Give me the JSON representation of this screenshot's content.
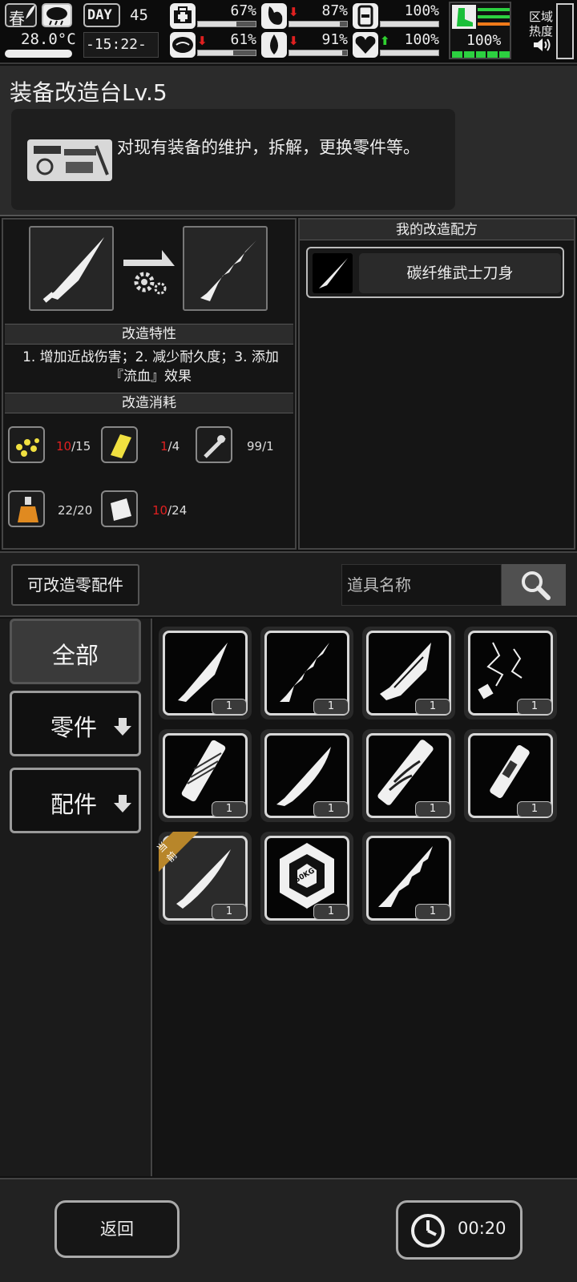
{
  "status": {
    "season": "春",
    "temperature": "28.0°C",
    "day_label": "DAY",
    "day_number": "45",
    "time": "-15:22-",
    "stats": [
      {
        "icon": "medkit-icon",
        "value": "67%",
        "trend": "none",
        "level": 0.67
      },
      {
        "icon": "stomach-icon",
        "value": "87%",
        "trend": "down",
        "level": 0.87
      },
      {
        "icon": "battery-icon",
        "value": "100%",
        "trend": "none",
        "level": 1.0
      },
      {
        "icon": "brain-icon",
        "value": "61%",
        "trend": "down",
        "level": 0.61
      },
      {
        "icon": "water-drop-icon",
        "value": "91%",
        "trend": "down",
        "level": 0.91
      },
      {
        "icon": "heart-icon",
        "value": "100%",
        "trend": "up",
        "level": 1.0
      }
    ],
    "stamina_value": "100%",
    "zone_heat_label_line1": "区域",
    "zone_heat_label_line2": "热度"
  },
  "header": {
    "title": "装备改造台Lv.5",
    "description": "对现有装备的维护，拆解，更换零件等。"
  },
  "recipe": {
    "traits_title": "改造特性",
    "traits_line1": "1. 增加近战伤害；2. 减少耐久度；3. 添加",
    "traits_line2": "『流血』效果",
    "cost_title": "改造消耗",
    "costs": [
      {
        "icon": "scrap-pile-icon",
        "have": "10",
        "need": "15",
        "insufficient": true
      },
      {
        "icon": "gold-bar-icon",
        "have": "1",
        "need": "4",
        "insufficient": true
      },
      {
        "icon": "grinder-tool-icon",
        "have": "99",
        "need": "1",
        "insufficient": false
      },
      {
        "icon": "chemical-flask-icon",
        "have": "22",
        "need": "20",
        "insufficient": false
      },
      {
        "icon": "cloth-sheet-icon",
        "have": "10",
        "need": "24",
        "insufficient": true
      }
    ],
    "my_recipes_title": "我的改造配方",
    "recipe_item_name": "碳纤维武士刀身"
  },
  "search": {
    "parts_label": "可改造零配件",
    "placeholder": "道具名称"
  },
  "sidebar": {
    "items": [
      {
        "label": "全部",
        "active": true
      },
      {
        "label": "零件",
        "active": false
      },
      {
        "label": "配件",
        "active": false
      }
    ]
  },
  "grid": {
    "current_tag": "当前",
    "items": [
      {
        "icon": "blade-icon",
        "count": "1"
      },
      {
        "icon": "serrated-blade-icon",
        "count": "1"
      },
      {
        "icon": "wide-blade-icon",
        "count": "1"
      },
      {
        "icon": "wire-key-icon",
        "count": "1"
      },
      {
        "icon": "wrapped-handle-icon",
        "count": "1"
      },
      {
        "icon": "curved-blade-icon",
        "count": "1"
      },
      {
        "icon": "decorated-handle-icon",
        "count": "1"
      },
      {
        "icon": "short-handle-icon",
        "count": "1"
      },
      {
        "icon": "katana-blade-icon",
        "count": "1",
        "current": true
      },
      {
        "icon": "weight-50kg-icon",
        "count": "1",
        "weight_label": "50KG"
      },
      {
        "icon": "jagged-blade-icon",
        "count": "1"
      }
    ]
  },
  "bottom": {
    "back_label": "返回",
    "timer": "00:20"
  }
}
